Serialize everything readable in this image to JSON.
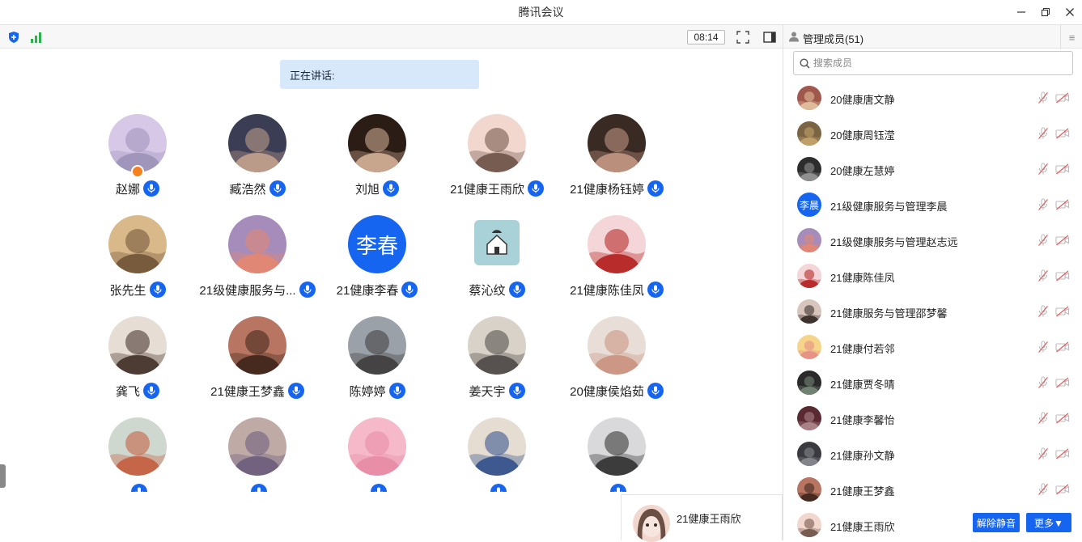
{
  "window": {
    "title": "腾讯会议",
    "minimize_icon": "minimize-icon",
    "restore_icon": "restore-icon",
    "close_icon": "close-icon"
  },
  "toolbar": {
    "timer": "08:14"
  },
  "stage": {
    "speaking_label": "正在讲话:",
    "participants": [
      {
        "name": "赵娜",
        "avatar_colors": [
          "#d7c8e8",
          "#9a8fb6"
        ],
        "host": true
      },
      {
        "name": "臧浩然",
        "avatar_colors": [
          "#3b3d55",
          "#c9a58f"
        ]
      },
      {
        "name": "刘旭",
        "avatar_colors": [
          "#2b1d16",
          "#d9b49a"
        ]
      },
      {
        "name": "21健康王雨欣",
        "avatar_colors": [
          "#f2d7cf",
          "#6b4f44"
        ]
      },
      {
        "name": "21健康杨钰婷",
        "avatar_colors": [
          "#3a2a24",
          "#c99c88"
        ]
      },
      {
        "name": "张先生",
        "avatar_colors": [
          "#d9b98a",
          "#6c5134"
        ]
      },
      {
        "name": "21级健康服务与...",
        "avatar_colors": [
          "#a58cba",
          "#e8866e"
        ]
      },
      {
        "name": "21健康李春",
        "avatar_text": "李春"
      },
      {
        "name": "蔡沁纹",
        "avatar_colors": [
          "#a9d1d8",
          "#6c8f96"
        ]
      },
      {
        "name": "21健康陈佳凤",
        "avatar_colors": [
          "#f4d6d8",
          "#b31b1b"
        ]
      },
      {
        "name": "龚飞",
        "avatar_colors": [
          "#e6ddd4",
          "#3c2a22"
        ]
      },
      {
        "name": "21健康王梦鑫",
        "avatar_colors": [
          "#b87561",
          "#3a2219"
        ]
      },
      {
        "name": "陈婷婷",
        "avatar_colors": [
          "#9aa1a8",
          "#3d3a3a"
        ]
      },
      {
        "name": "姜天宇",
        "avatar_colors": [
          "#d8d2c8",
          "#4a4542"
        ]
      },
      {
        "name": "20健康侯焰茹",
        "avatar_colors": [
          "#e8ded7",
          "#c98f7b"
        ]
      },
      {
        "name": "",
        "avatar_colors": [
          "#cfd8cf",
          "#c55a3a"
        ]
      },
      {
        "name": "",
        "avatar_colors": [
          "#bfaaa6",
          "#6a5a7a"
        ]
      },
      {
        "name": "",
        "avatar_colors": [
          "#f5b9c9",
          "#e88aa4"
        ]
      },
      {
        "name": "",
        "avatar_colors": [
          "#e6ddd2",
          "#2b4b8a"
        ]
      },
      {
        "name": "",
        "avatar_colors": [
          "#d9d9dc",
          "#2a2a2a"
        ]
      }
    ],
    "self": {
      "name": "21健康王雨欣"
    }
  },
  "panel": {
    "title": "管理成员(51)",
    "search_placeholder": "搜索成员",
    "unmute_label": "解除静音",
    "more_label": "更多▼",
    "members": [
      {
        "name": "20健康唐文静",
        "avatar_colors": [
          "#a0574c",
          "#e6c6a3"
        ]
      },
      {
        "name": "20健康周钰滢",
        "avatar_colors": [
          "#7a6444",
          "#c8a56e"
        ]
      },
      {
        "name": "20健康左慧婷",
        "avatar_colors": [
          "#2d2d2d",
          "#9a9a9a"
        ]
      },
      {
        "name": "21级健康服务与管理李晨",
        "avatar_text": "李晨"
      },
      {
        "name": "21级健康服务与管理赵志远",
        "avatar_colors": [
          "#a58cba",
          "#e8866e"
        ]
      },
      {
        "name": "21健康陈佳凤",
        "avatar_colors": [
          "#f4d6d8",
          "#b31b1b"
        ]
      },
      {
        "name": "21健康服务与管理邵梦馨",
        "avatar_colors": [
          "#d8c6bd",
          "#2f2320"
        ]
      },
      {
        "name": "21健康付若邻",
        "avatar_colors": [
          "#f6d58a",
          "#e48b86"
        ]
      },
      {
        "name": "21健康贾冬晴",
        "avatar_colors": [
          "#2a2a2a",
          "#7a8c7a"
        ]
      },
      {
        "name": "21健康李馨怡",
        "avatar_colors": [
          "#5a2a32",
          "#b58a8f"
        ]
      },
      {
        "name": "21健康孙文静",
        "avatar_colors": [
          "#3a3a40",
          "#8c8c94"
        ]
      },
      {
        "name": "21健康王梦鑫",
        "avatar_colors": [
          "#b87561",
          "#3a2219"
        ]
      },
      {
        "name": "21健康王雨欣",
        "avatar_colors": [
          "#f2d7cf",
          "#6b4f44"
        ],
        "hover": true
      }
    ]
  }
}
